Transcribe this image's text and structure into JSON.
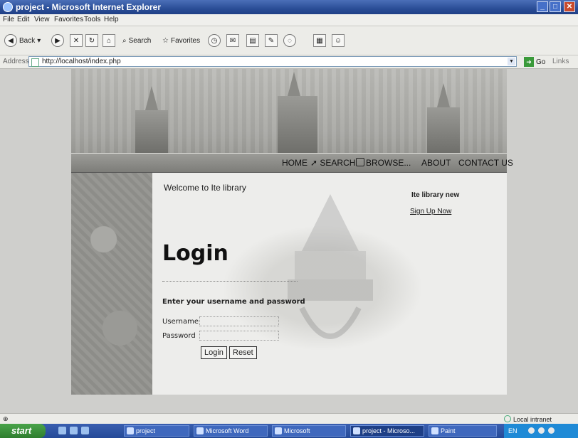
{
  "window": {
    "title": "project - Microsoft Internet Explorer"
  },
  "menu": [
    "File",
    "Edit",
    "View",
    "Favorites",
    "Tools",
    "Help"
  ],
  "toolbar": {
    "back": "Back",
    "search": "Search",
    "favorites": "Favorites"
  },
  "address": {
    "label": "Address",
    "url": "http://localhost/index.php",
    "go": "Go",
    "links": "Links"
  },
  "site": {
    "nav": [
      "HOME",
      "SEARCH",
      "BROWSE...",
      "ABOUT",
      "CONTACT US"
    ],
    "welcome": "Welcome to Ite library",
    "login_title": "Login",
    "instruction": "Enter your username and password",
    "username_label": "Username",
    "password_label": "Password",
    "login_button": "Login",
    "reset_button": "Reset",
    "side_heading": "Ite library new",
    "signup_link": "Sign Up Now"
  },
  "status": {
    "zone": "Local intranet"
  },
  "taskbar": {
    "start": "start",
    "tasks": [
      "project",
      "Microsoft Word",
      "Microsoft",
      "project - Microso...",
      "Paint"
    ],
    "lang": "EN"
  }
}
